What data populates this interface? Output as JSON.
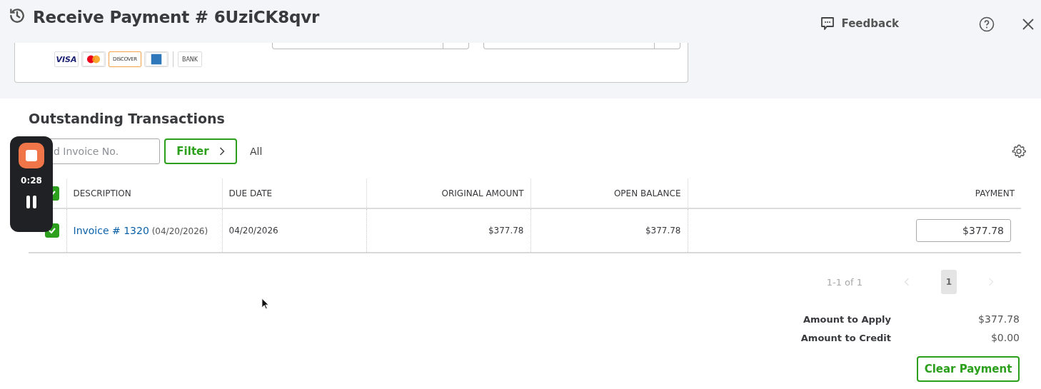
{
  "header": {
    "title": "Receive Payment # 6UziCK8qvr",
    "feedback": "Feedback"
  },
  "payment_methods": [
    {
      "kind": "visa",
      "label": "VISA"
    },
    {
      "kind": "mastercard"
    },
    {
      "kind": "discover",
      "label": "DISCOVER"
    },
    {
      "kind": "amex"
    },
    {
      "kind": "bank",
      "label": "BANK"
    }
  ],
  "outstanding": {
    "title": "Outstanding Transactions",
    "search": {
      "placeholder": "d Invoice No."
    },
    "filter": "Filter",
    "filter_value": "All"
  },
  "table": {
    "select_all": {
      "checked": true
    },
    "columns": [
      "DESCRIPTION",
      "DUE DATE",
      "ORIGINAL AMOUNT",
      "OPEN BALANCE",
      "PAYMENT"
    ],
    "rows": [
      {
        "checked": true,
        "invoice": "Invoice # 1320",
        "invoice_date": "(04/20/2026)",
        "due_date": "04/20/2026",
        "original_amount": "$377.78",
        "open_balance": "$377.78",
        "payment": "$377.78"
      }
    ]
  },
  "pagination": {
    "range": "1-1 of 1",
    "pages": [
      {
        "label": "1",
        "selected": true
      }
    ]
  },
  "totals": [
    {
      "label": "Amount to Apply",
      "value": "$377.78"
    },
    {
      "label": "Amount to Credit",
      "value": "$0.00"
    }
  ],
  "clear_button": "Clear Payment",
  "recorder": {
    "time": "0:28"
  }
}
